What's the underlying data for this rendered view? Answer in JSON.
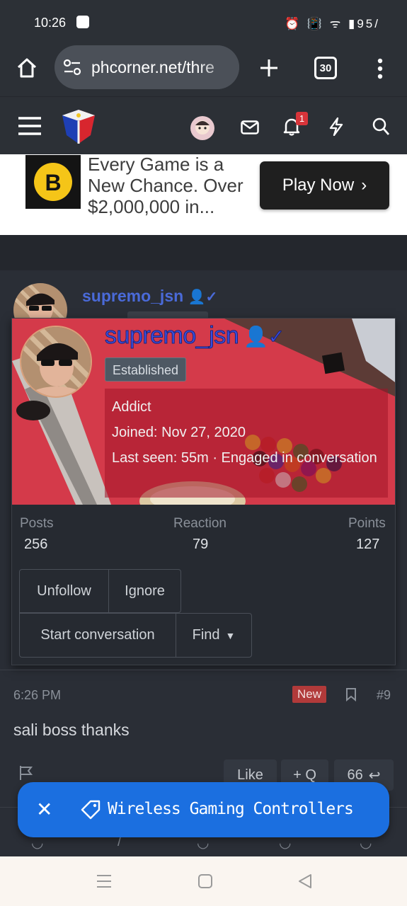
{
  "status_bar": {
    "time": "10:26",
    "battery": "95"
  },
  "browser": {
    "url": "phcorner.net/thre",
    "tab_count": "30"
  },
  "site_header": {
    "notification_count": "1"
  },
  "ad": {
    "text": "Every Game is a New Chance. Over $2,000,000 in...",
    "button_label": "Play Now",
    "logo_letter": "B"
  },
  "post": {
    "username": "supremo_jsn",
    "time": "6:26 PM",
    "new_badge": "New",
    "post_number": "#9",
    "message": "sali boss thanks",
    "actions": {
      "like": "Like",
      "quote": "+ Q",
      "reply": "66"
    }
  },
  "member_card": {
    "username": "supremo_jsn",
    "badge": "Established",
    "title": "Addict",
    "joined_label": "Joined:",
    "joined_value": "Nov 27, 2020",
    "last_seen_label": "Last seen:",
    "last_seen_value": "55m · Engaged in conversation",
    "stats": {
      "posts_label": "Posts",
      "posts_value": "256",
      "reaction_label": "Reaction",
      "reaction_value": "79",
      "points_label": "Points",
      "points_value": "127"
    },
    "buttons": {
      "unfollow": "Unfollow",
      "ignore": "Ignore",
      "start_conversation": "Start conversation",
      "find": "Find"
    }
  },
  "toast": {
    "text": "Wireless Gaming Controllers"
  },
  "colors": {
    "accent_blue": "#1b6fe0",
    "username_blue": "#4a6ad8",
    "new_badge": "#b13a3a"
  }
}
